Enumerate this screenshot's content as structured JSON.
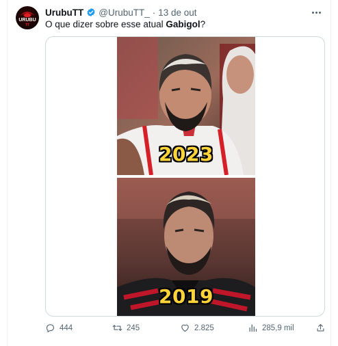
{
  "tweet": {
    "author_name": "UrubuTT",
    "handle": "@UrubuTT_",
    "separator": "·",
    "date": "13 de out",
    "text_before": "O que dizer sobre esse atual ",
    "text_bold": "Gabigol",
    "text_after": "?",
    "avatar_text": "URUBU",
    "avatar_sub": "TT"
  },
  "media": {
    "top_caption": "2023",
    "bottom_caption": "2019"
  },
  "actions": {
    "replies": "444",
    "retweets": "245",
    "likes": "2.825",
    "views": "285,9 mil"
  },
  "colors": {
    "verified": "#1d9bf0",
    "secondary_text": "#536471",
    "caption": "#ffd43b"
  },
  "icons": {
    "more": "more-icon",
    "reply": "reply-icon",
    "retweet": "retweet-icon",
    "like": "heart-icon",
    "views": "views-icon",
    "share": "share-icon",
    "verified": "verified-badge-icon"
  }
}
